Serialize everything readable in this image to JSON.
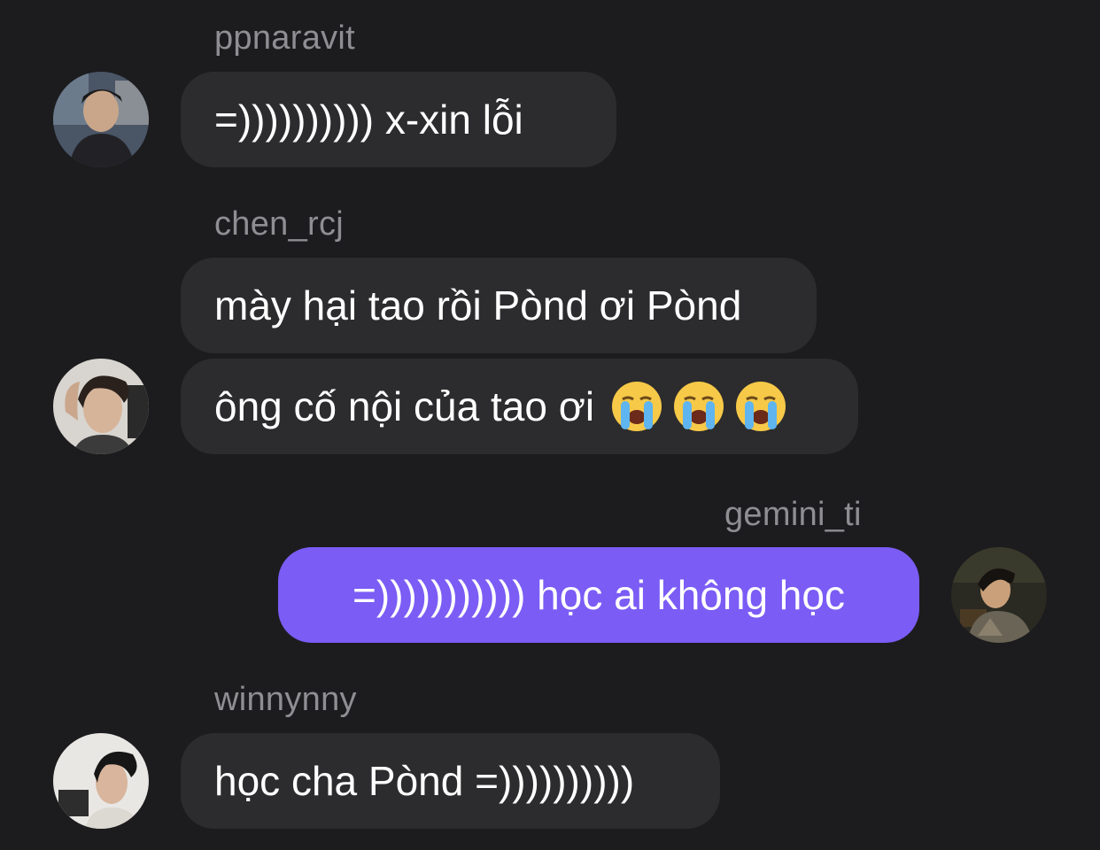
{
  "messages": [
    {
      "sender": "ppnaravit",
      "text": "=)))))))))) x-xin lỗi",
      "direction": "incoming",
      "avatar": "user-photo-avatar"
    },
    {
      "sender": "chen_rcj",
      "text": "mày hại tao rồi Pònd ơi Pònd",
      "direction": "incoming",
      "avatar": null
    },
    {
      "sender": null,
      "text": "ông cố nội của tao ơi",
      "emoji": [
        "loudly-crying-face-icon",
        "loudly-crying-face-icon",
        "loudly-crying-face-icon"
      ],
      "direction": "incoming",
      "avatar": "user-photo-avatar"
    },
    {
      "sender": "gemini_ti",
      "text": "=))))))))))) học ai không học",
      "direction": "outgoing",
      "avatar": "user-photo-avatar"
    },
    {
      "sender": "winnynny",
      "text": "học cha Pònd =))))))))))",
      "direction": "incoming",
      "avatar": "user-photo-avatar"
    }
  ],
  "colors": {
    "background": "#1c1c1e",
    "incoming_bubble": "#2c2c2e",
    "outgoing_bubble": "#7b5cf5",
    "sender_name": "#8e8e93",
    "message_text": "#ffffff"
  }
}
